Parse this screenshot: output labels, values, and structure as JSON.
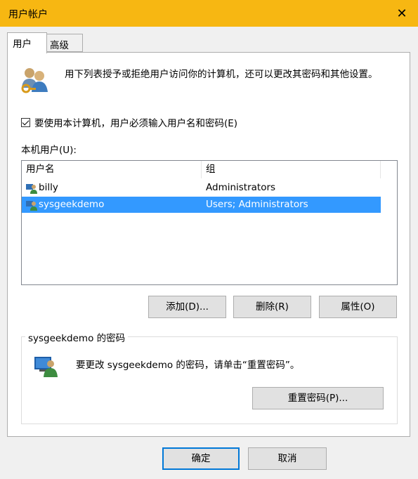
{
  "window": {
    "title": "用户帐户",
    "close_glyph": "✕"
  },
  "tabs": [
    {
      "label": "用户",
      "active": true
    },
    {
      "label": "高级",
      "active": false
    }
  ],
  "info": {
    "icon": "users-key-icon",
    "text": "用下列表授予或拒绝用户访问你的计算机，还可以更改其密码和其他设置。"
  },
  "require_login": {
    "checked": true,
    "label": "要使用本计算机，用户必须输入用户名和密码(E)"
  },
  "users": {
    "label": "本机用户(U):",
    "columns": [
      "用户名",
      "组"
    ],
    "rows": [
      {
        "name": "billy",
        "group": "Administrators",
        "selected": false
      },
      {
        "name": "sysgeekdemo",
        "group": "Users; Administrators",
        "selected": true
      }
    ]
  },
  "buttons": {
    "add": "添加(D)...",
    "remove": "删除(R)",
    "properties": "属性(O)"
  },
  "password": {
    "group_title": "sysgeekdemo 的密码",
    "icon": "user-monitor-icon",
    "text": "要更改 sysgeekdemo 的密码，请单击“重置密码”。",
    "reset_button": "重置密码(P)..."
  },
  "footer": {
    "ok": "确定",
    "cancel": "取消"
  },
  "colors": {
    "titlebar": "#f7b712",
    "selection": "#3399ff",
    "focus_border": "#0078d7"
  }
}
